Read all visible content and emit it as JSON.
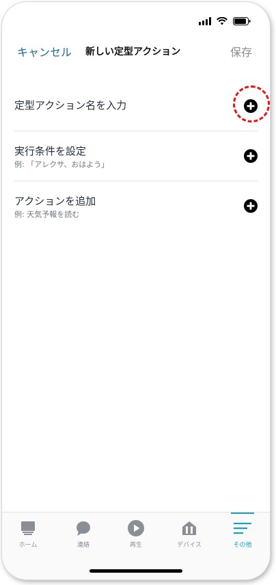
{
  "header": {
    "cancel_label": "キャンセル",
    "title": "新しい定型アクション",
    "save_label": "保存"
  },
  "rows": [
    {
      "title": "定型アクション名を入力",
      "subtitle": ""
    },
    {
      "title": "実行条件を設定",
      "subtitle": "例: 「アレクサ、おはよう」"
    },
    {
      "title": "アクションを追加",
      "subtitle": "例: 天気予報を読む"
    }
  ],
  "nav": [
    {
      "label": "ホーム",
      "icon": "home-icon"
    },
    {
      "label": "連絡",
      "icon": "chat-bubble-icon"
    },
    {
      "label": "再生",
      "icon": "play-icon"
    },
    {
      "label": "デバイス",
      "icon": "devices-icon"
    },
    {
      "label": "その他",
      "icon": "menu-icon"
    }
  ],
  "colors": {
    "accent": "#1aa0c2",
    "link": "#1f6b8a",
    "highlight": "#e8141b"
  }
}
